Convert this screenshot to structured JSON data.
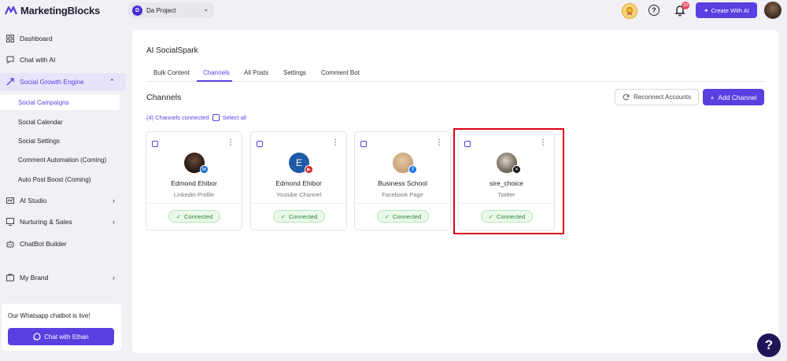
{
  "app": {
    "name": "MarketingBlocks"
  },
  "header": {
    "project_initial": "D",
    "project_name": "Da Project",
    "notification_count": "10",
    "create_ai_label": "Create With AI"
  },
  "sidebar": {
    "items": [
      {
        "label": "Dashboard",
        "icon": "dashboard-icon"
      },
      {
        "label": "Chat with AI",
        "icon": "chat-icon"
      },
      {
        "label": "Social Growth Engine",
        "icon": "growth-icon"
      }
    ],
    "subitems": [
      {
        "label": "Social Campaigns"
      },
      {
        "label": "Social Calendar"
      },
      {
        "label": "Social Settings"
      },
      {
        "label": "Comment Automation (Coming)"
      },
      {
        "label": "Auto Post Boost (Coming)"
      }
    ],
    "more_items": [
      {
        "label": "AI Studio",
        "icon": "ai-studio-icon"
      },
      {
        "label": "Nurturing & Sales",
        "icon": "nurturing-icon"
      },
      {
        "label": "ChatBot Builder",
        "icon": "chatbot-icon"
      },
      {
        "label": "My Brand",
        "icon": "brand-icon"
      }
    ],
    "promo_text": "Our Whatsapp chatbot is live!",
    "promo_button": "Chat with Ethan"
  },
  "main": {
    "title": "AI SocialSpark",
    "tabs": [
      {
        "label": "Bulk Content"
      },
      {
        "label": "Channels"
      },
      {
        "label": "All Posts"
      },
      {
        "label": "Settings"
      },
      {
        "label": "Comment Bot"
      }
    ],
    "active_tab": "Channels",
    "section_title": "Channels",
    "reconnect_label": "Reconnect Accounts",
    "add_channel_label": "Add Channel",
    "connected_count": "(4) Channels connected",
    "select_all": "Select all",
    "channels": [
      {
        "name": "Edmond Ehibor",
        "type": "Linkedin Profile",
        "status": "Connected",
        "network": "linkedin",
        "network_color": "#0a66c2"
      },
      {
        "name": "Edmond Ehibor",
        "type": "Youtube Channel",
        "status": "Connected",
        "network": "youtube",
        "network_color": "#e02020",
        "avatar_initial": "E"
      },
      {
        "name": "Business School",
        "type": "Facebook Page",
        "status": "Connected",
        "network": "facebook",
        "network_color": "#1877f2"
      },
      {
        "name": "sire_choice",
        "type": "Twitter",
        "status": "Connected",
        "network": "x",
        "network_color": "#111111"
      }
    ]
  },
  "colors": {
    "accent": "#5b3fe0",
    "highlight": "#e0001b",
    "connected": "#2f7d32"
  }
}
